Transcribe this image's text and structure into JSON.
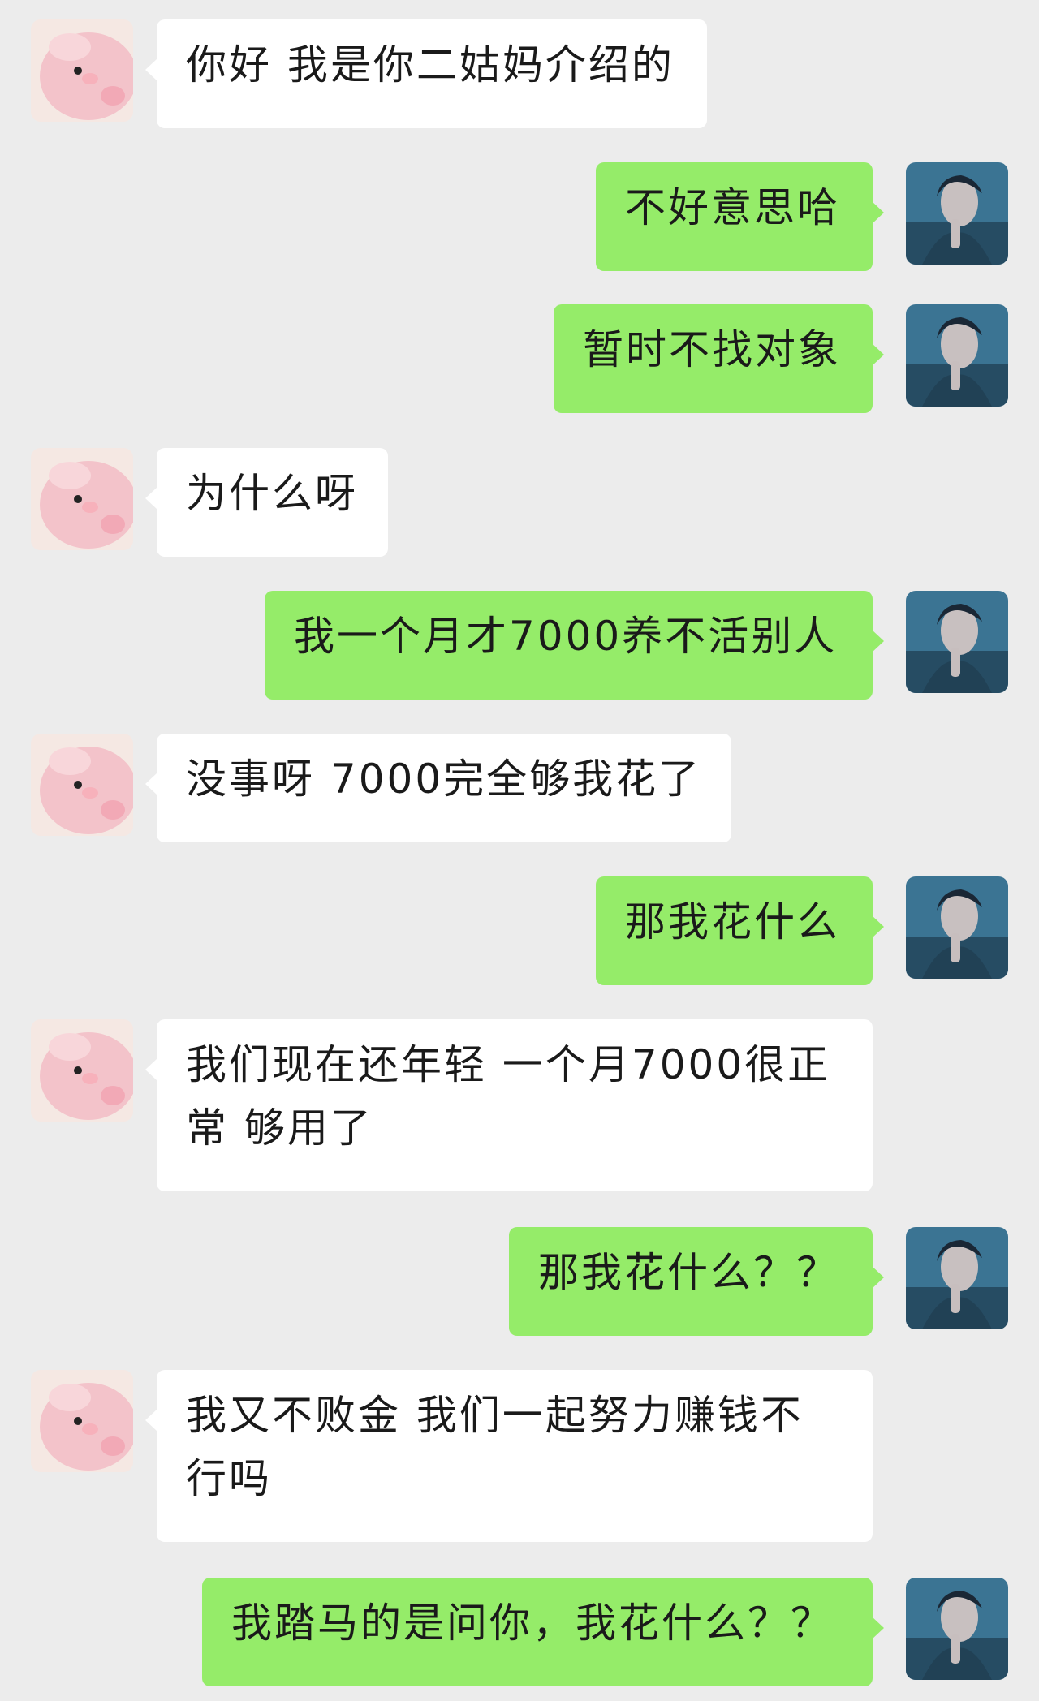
{
  "conversation": {
    "messages": [
      {
        "side": "in",
        "text": "你好 我是你二姑妈介绍的"
      },
      {
        "side": "out",
        "text": "不好意思哈"
      },
      {
        "side": "out",
        "text": "暂时不找对象"
      },
      {
        "side": "in",
        "text": "为什么呀"
      },
      {
        "side": "out",
        "text": "我一个月才7000养不活别人"
      },
      {
        "side": "in",
        "text": "没事呀 7000完全够我花了"
      },
      {
        "side": "out",
        "text": "那我花什么"
      },
      {
        "side": "in",
        "text": "我们现在还年轻 一个月7000很正常 够用了"
      },
      {
        "side": "out",
        "text": "那我花什么？？"
      },
      {
        "side": "in",
        "text": "我又不败金 我们一起努力赚钱不行吗"
      },
      {
        "side": "out",
        "text": "我踏马的是问你，我花什么？？"
      }
    ]
  },
  "avatars": {
    "left": {
      "icon": "pink-bird-plush-avatar-icon",
      "color": "#f3c3ca"
    },
    "right": {
      "icon": "man-portrait-avatar-icon",
      "color": "#2f5670"
    }
  },
  "colors": {
    "background": "#ececec",
    "incoming_bubble": "#ffffff",
    "outgoing_bubble": "#95ec69",
    "text": "#1a1a1a"
  }
}
